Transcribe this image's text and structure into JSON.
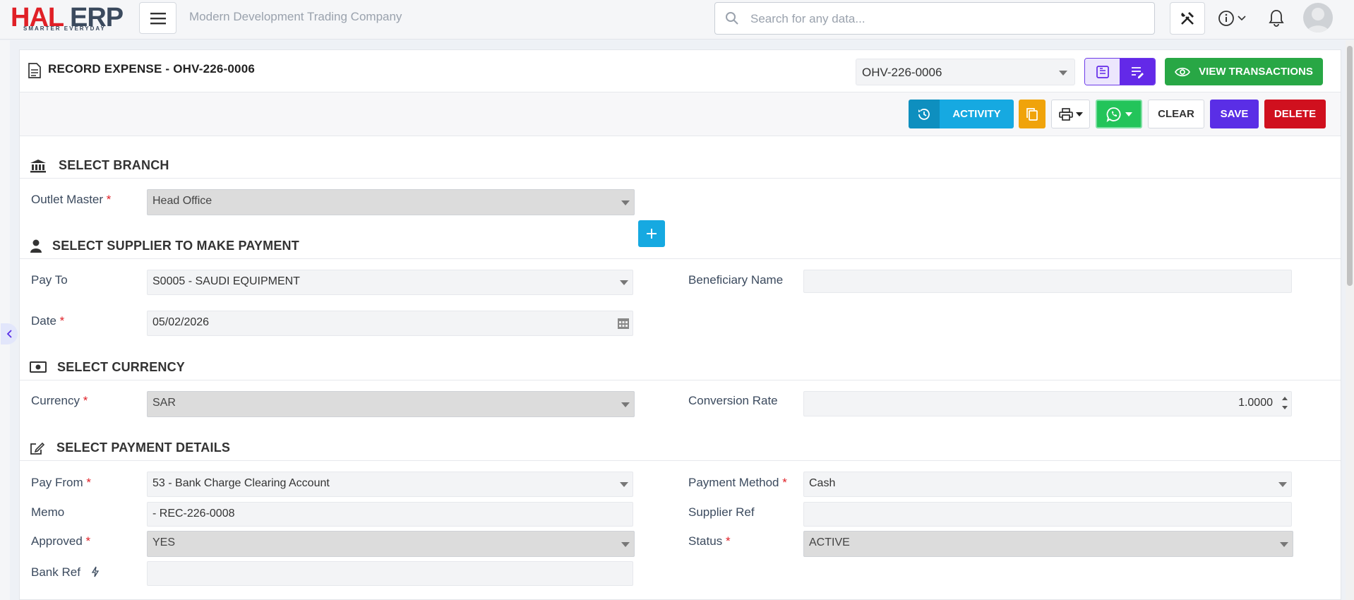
{
  "brand": {
    "logo_left": "HAL",
    "logo_right": "ERP",
    "tagline": "SMARTER EVERYDAY"
  },
  "header": {
    "company": "Modern Development Trading Company",
    "search_placeholder": "Search for any data..."
  },
  "page": {
    "title": "RECORD EXPENSE - OHV-226-0006",
    "record_selector": "OHV-226-0006",
    "view_transactions": "VIEW TRANSACTIONS"
  },
  "toolbar": {
    "activity": "ACTIVITY",
    "clear": "CLEAR",
    "save": "SAVE",
    "delete": "DELETE"
  },
  "sections": {
    "branch": "SELECT BRANCH",
    "supplier": "SELECT SUPPLIER TO MAKE PAYMENT",
    "currency": "SELECT CURRENCY",
    "payment": "SELECT PAYMENT DETAILS"
  },
  "form": {
    "outlet_master": {
      "label": "Outlet Master",
      "value": "Head Office"
    },
    "pay_to": {
      "label": "Pay To",
      "value": "S0005 - SAUDI EQUIPMENT"
    },
    "beneficiary_name": {
      "label": "Beneficiary Name",
      "value": ""
    },
    "date": {
      "label": "Date",
      "value": "05/02/2026"
    },
    "currency": {
      "label": "Currency",
      "value": "SAR"
    },
    "conversion_rate": {
      "label": "Conversion Rate",
      "value": "1.0000"
    },
    "pay_from": {
      "label": "Pay From",
      "value": "53 - Bank Charge Clearing Account"
    },
    "payment_method": {
      "label": "Payment Method",
      "value": "Cash"
    },
    "memo": {
      "label": "Memo",
      "value": " - REC-226-0008"
    },
    "supplier_ref": {
      "label": "Supplier Ref",
      "value": ""
    },
    "approved": {
      "label": "Approved",
      "value": "YES"
    },
    "status": {
      "label": "Status",
      "value": "ACTIVE"
    },
    "bank_ref": {
      "label": "Bank Ref",
      "value": ""
    }
  },
  "required_mark": "*",
  "colors": {
    "brand_red": "#e02027",
    "primary_purple": "#5a2ee6",
    "success_green": "#28a745",
    "info_blue": "#16a9e1",
    "danger_red": "#d0101e",
    "warning_orange": "#f0a30a"
  }
}
